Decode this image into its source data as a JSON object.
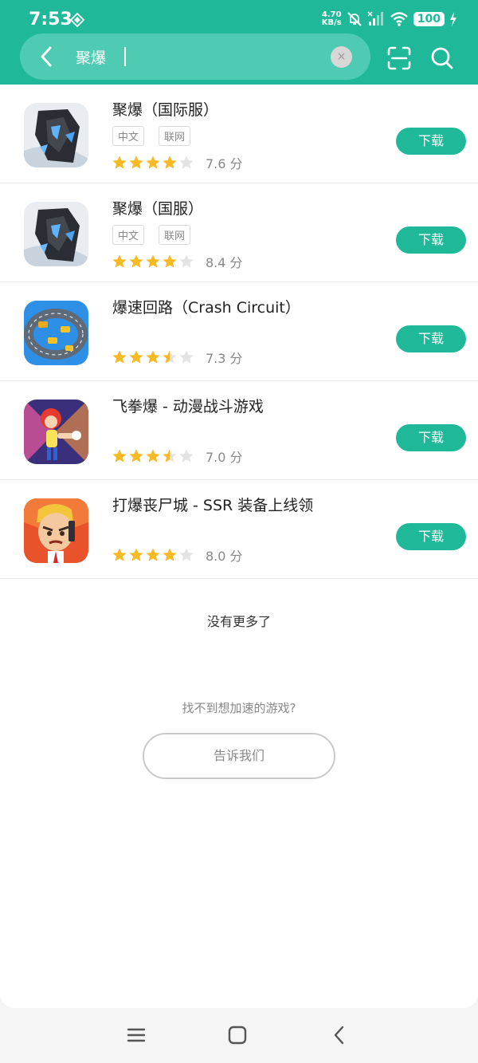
{
  "status_bar": {
    "time": "7:53",
    "net_speed_value": "4.70",
    "net_speed_unit": "KB/s",
    "battery": "100"
  },
  "search": {
    "query": "聚爆",
    "clear_label": "×"
  },
  "apps": [
    {
      "title": "聚爆（国际服）",
      "tags": [
        "中文",
        "联网"
      ],
      "rating": 4,
      "score": "7.6 分",
      "button": "下载"
    },
    {
      "title": "聚爆（国服）",
      "tags": [
        "中文",
        "联网"
      ],
      "rating": 4,
      "score": "8.4 分",
      "button": "下载"
    },
    {
      "title": "爆速回路（Crash Circuit）",
      "tags": [],
      "rating": 3.5,
      "score": "7.3 分",
      "button": "下载"
    },
    {
      "title": "飞拳爆 - 动漫战斗游戏",
      "tags": [],
      "rating": 3.5,
      "score": "7.0 分",
      "button": "下载"
    },
    {
      "title": "打爆丧尸城 - SSR 装备上线领",
      "tags": [],
      "rating": 4,
      "score": "8.0 分",
      "button": "下载"
    }
  ],
  "footer": {
    "no_more": "没有更多了",
    "cant_find": "找不到想加速的游戏?",
    "tell_us": "告诉我们"
  },
  "colors": {
    "accent": "#1fb99a",
    "star": "#f7b924",
    "star_empty": "#e3e3e3"
  },
  "icons": {
    "back": "chevron-left-icon",
    "scan": "scan-icon",
    "search": "search-icon",
    "nav_menu": "menu-icon",
    "nav_home": "home-icon",
    "nav_back": "back-icon"
  }
}
